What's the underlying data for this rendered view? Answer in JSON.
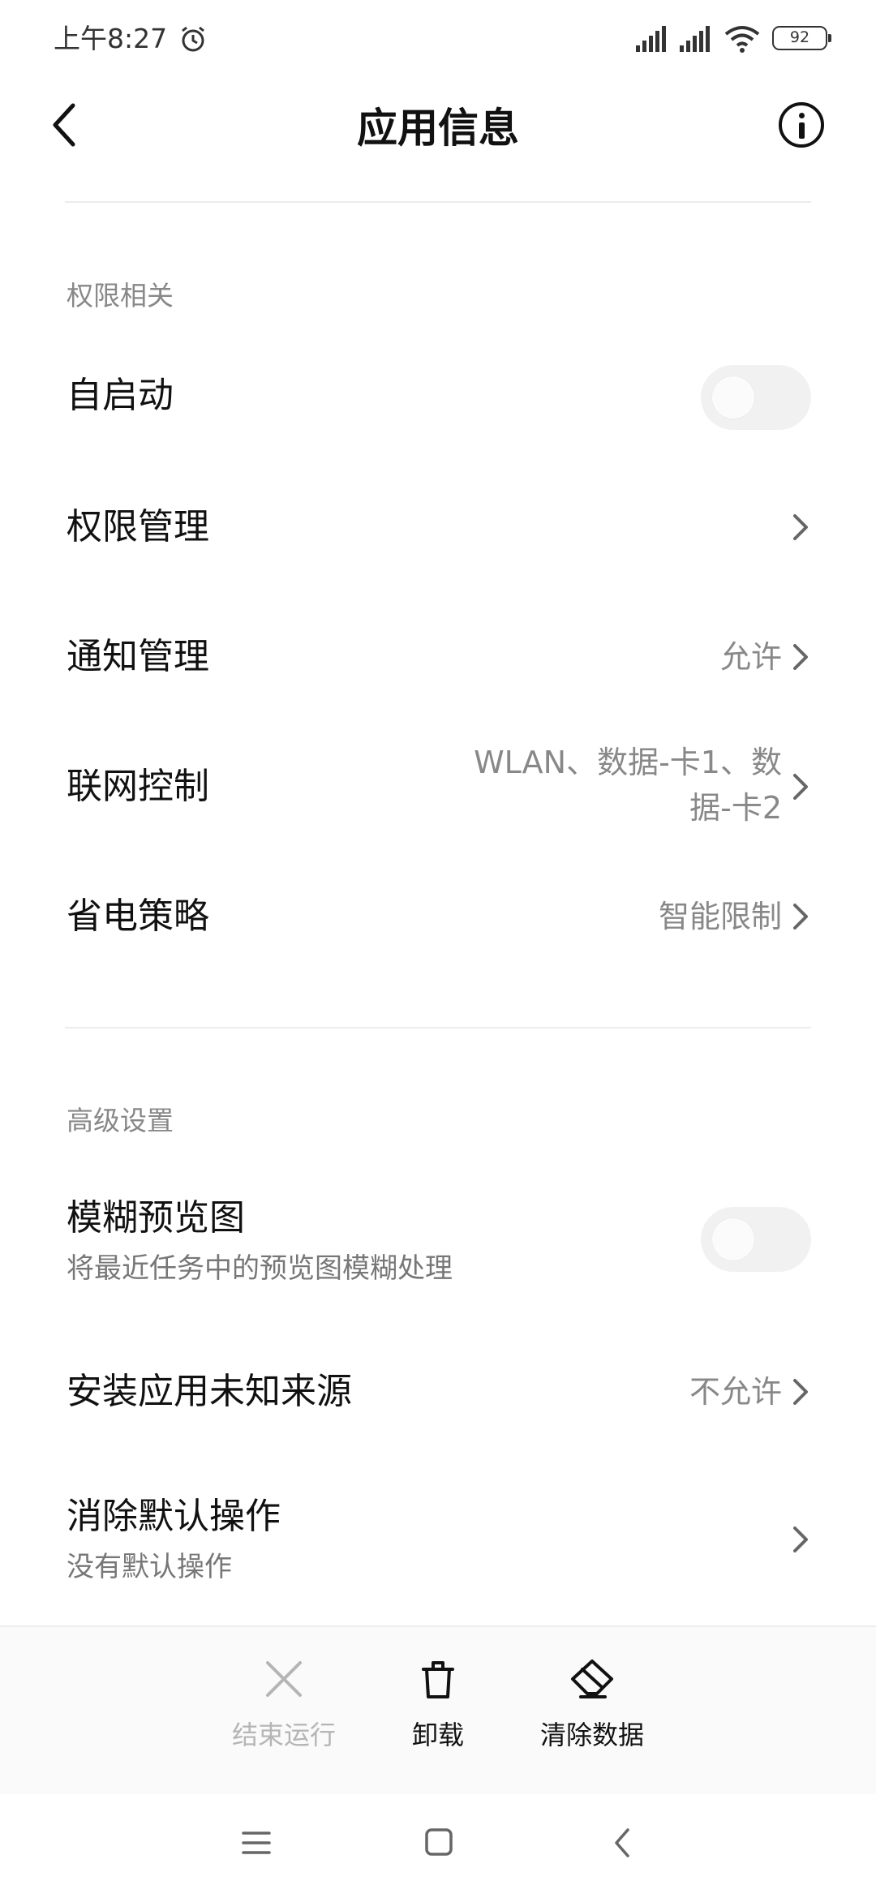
{
  "status_bar": {
    "time": "上午8:27",
    "battery": "92"
  },
  "header": {
    "title": "应用信息"
  },
  "sections": {
    "permissions": {
      "label": "权限相关",
      "autostart": {
        "title": "自启动",
        "enabled": false
      },
      "permission_mgmt": {
        "title": "权限管理"
      },
      "notification_mgmt": {
        "title": "通知管理",
        "value": "允许"
      },
      "network_control": {
        "title": "联网控制",
        "value_line1": "WLAN、数据-卡1、数",
        "value_line2": "据-卡2"
      },
      "battery_saver": {
        "title": "省电策略",
        "value": "智能限制"
      }
    },
    "advanced": {
      "label": "高级设置",
      "blur_preview": {
        "title": "模糊预览图",
        "subtitle": "将最近任务中的预览图模糊处理",
        "enabled": false
      },
      "unknown_sources": {
        "title": "安装应用未知来源",
        "value": "不允许"
      },
      "clear_defaults": {
        "title": "消除默认操作",
        "subtitle": "没有默认操作"
      }
    }
  },
  "actions": {
    "force_stop": "结束运行",
    "uninstall": "卸载",
    "clear_data": "清除数据"
  },
  "colors": {
    "disabled": "#b5b5b5",
    "text": "#111111",
    "secondary": "#888888"
  }
}
